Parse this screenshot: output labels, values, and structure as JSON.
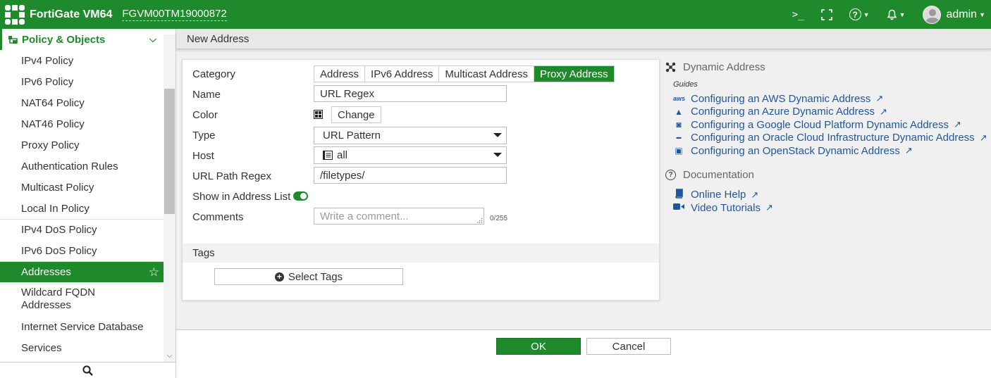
{
  "topbar": {
    "brand": "FortiGate VM64",
    "serial": "FGVM00TM19000872",
    "cli_glyph": ">_",
    "fullscreen_glyph": "⛶",
    "help_glyph": "?",
    "user": "admin"
  },
  "sidebar": {
    "section": "Policy & Objects",
    "items": [
      {
        "label": "IPv4 Policy"
      },
      {
        "label": "IPv6 Policy"
      },
      {
        "label": "NAT64 Policy"
      },
      {
        "label": "NAT46 Policy"
      },
      {
        "label": "Proxy Policy"
      },
      {
        "label": "Authentication Rules"
      },
      {
        "label": "Multicast Policy"
      },
      {
        "label": "Local In Policy"
      },
      {
        "label": "IPv4 DoS Policy"
      },
      {
        "label": "IPv6 DoS Policy"
      },
      {
        "label": "Addresses"
      },
      {
        "label": "Wildcard FQDN Addresses"
      },
      {
        "label": "Internet Service Database"
      },
      {
        "label": "Services"
      }
    ]
  },
  "page": {
    "title": "New Address"
  },
  "form": {
    "category_label": "Category",
    "categories": [
      "Address",
      "IPv6 Address",
      "Multicast Address",
      "Proxy Address"
    ],
    "selected_category": "Proxy Address",
    "name_label": "Name",
    "name_value": "URL Regex",
    "color_label": "Color",
    "color_button": "Change",
    "type_label": "Type",
    "type_value": "URL Pattern",
    "host_label": "Host",
    "host_value": "all",
    "url_path_label": "URL Path Regex",
    "url_path_value": "/filetypes/",
    "show_in_list_label": "Show in Address List",
    "show_in_list_enabled": true,
    "comments_label": "Comments",
    "comments_placeholder": "Write a comment...",
    "comments_counter": "0/255",
    "tags_label": "Tags",
    "select_tags_button": "Select Tags"
  },
  "right_panel": {
    "dynamic_title": "Dynamic Address",
    "guides_label": "Guides",
    "guides": [
      {
        "icon": "aws",
        "label": "Configuring an AWS Dynamic Address"
      },
      {
        "icon": "▲",
        "label": "Configuring an Azure Dynamic Address"
      },
      {
        "icon": "◙",
        "label": "Configuring a Google Cloud Platform Dynamic Address"
      },
      {
        "icon": "▬",
        "label": "Configuring an Oracle Cloud Infrastructure Dynamic Address"
      },
      {
        "icon": "▣",
        "label": "Configuring an OpenStack Dynamic Address"
      }
    ],
    "doc_title": "Documentation",
    "docs": [
      {
        "icon": "📘",
        "label": "Online Help"
      },
      {
        "icon": "■",
        "label": "Video Tutorials"
      }
    ]
  },
  "footer": {
    "ok": "OK",
    "cancel": "Cancel"
  },
  "colors": {
    "brand_green": "#1f8a2b",
    "link_blue": "#21579c"
  }
}
